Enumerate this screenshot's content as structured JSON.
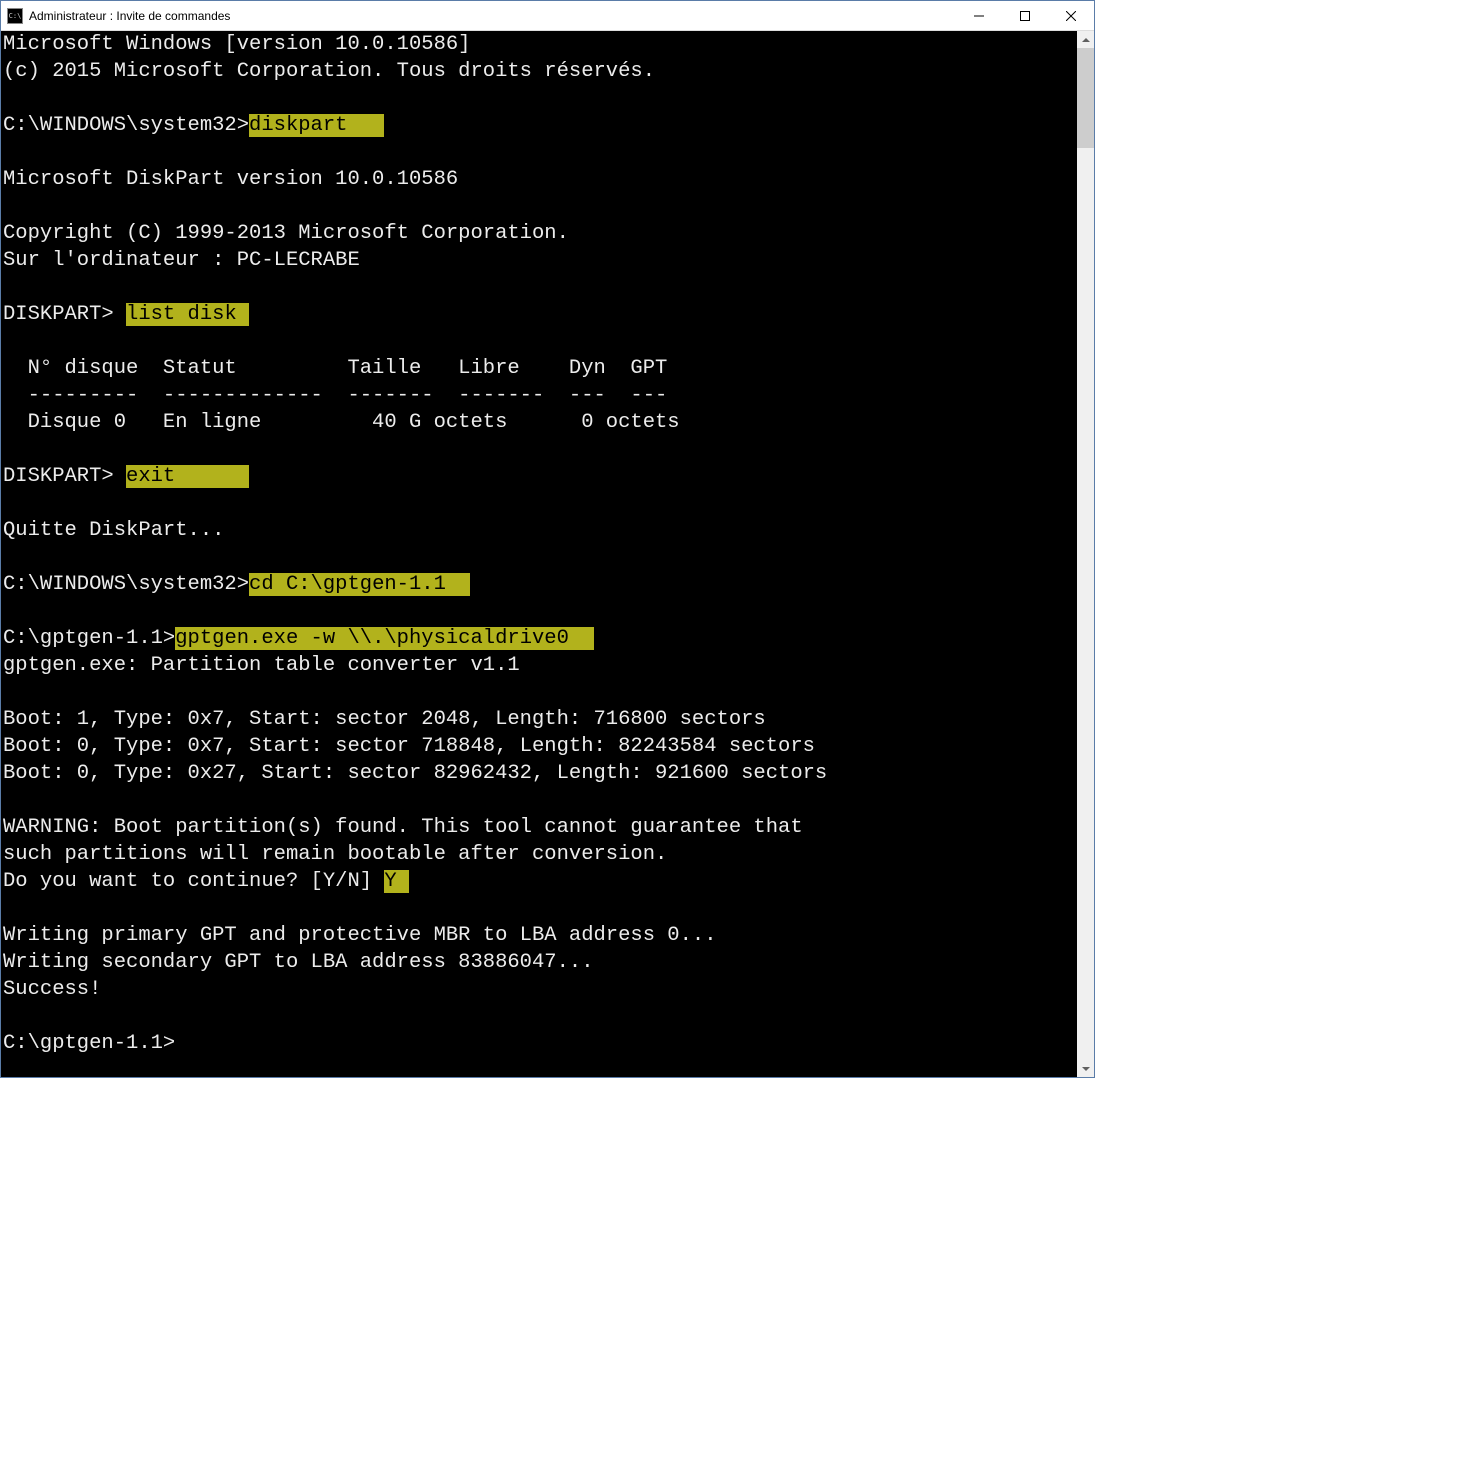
{
  "window": {
    "title": "Administrateur : Invite de commandes",
    "icon_label": "C:\\"
  },
  "terminal": {
    "lines": [
      {
        "segments": [
          {
            "text": "Microsoft Windows [version 10.0.10586]"
          }
        ]
      },
      {
        "segments": [
          {
            "text": "(c) 2015 Microsoft Corporation. Tous droits réservés."
          }
        ]
      },
      {
        "segments": [
          {
            "text": ""
          }
        ]
      },
      {
        "segments": [
          {
            "text": "C:\\WINDOWS\\system32>"
          },
          {
            "text": "diskpart   ",
            "hl": true
          }
        ]
      },
      {
        "segments": [
          {
            "text": ""
          }
        ]
      },
      {
        "segments": [
          {
            "text": "Microsoft DiskPart version 10.0.10586"
          }
        ]
      },
      {
        "segments": [
          {
            "text": ""
          }
        ]
      },
      {
        "segments": [
          {
            "text": "Copyright (C) 1999-2013 Microsoft Corporation."
          }
        ]
      },
      {
        "segments": [
          {
            "text": "Sur l'ordinateur : PC-LECRABE"
          }
        ]
      },
      {
        "segments": [
          {
            "text": ""
          }
        ]
      },
      {
        "segments": [
          {
            "text": "DISKPART> "
          },
          {
            "text": "list disk ",
            "hl": true
          }
        ]
      },
      {
        "segments": [
          {
            "text": ""
          }
        ]
      },
      {
        "segments": [
          {
            "text": "  N° disque  Statut         Taille   Libre    Dyn  GPT"
          }
        ]
      },
      {
        "segments": [
          {
            "text": "  ---------  -------------  -------  -------  ---  ---"
          }
        ]
      },
      {
        "segments": [
          {
            "text": "  Disque 0   En ligne         40 G octets      0 octets"
          }
        ]
      },
      {
        "segments": [
          {
            "text": ""
          }
        ]
      },
      {
        "segments": [
          {
            "text": "DISKPART> "
          },
          {
            "text": "exit      ",
            "hl": true
          }
        ]
      },
      {
        "segments": [
          {
            "text": ""
          }
        ]
      },
      {
        "segments": [
          {
            "text": "Quitte DiskPart..."
          }
        ]
      },
      {
        "segments": [
          {
            "text": ""
          }
        ]
      },
      {
        "segments": [
          {
            "text": "C:\\WINDOWS\\system32>"
          },
          {
            "text": "cd C:\\gptgen-1.1  ",
            "hl": true
          }
        ]
      },
      {
        "segments": [
          {
            "text": ""
          }
        ]
      },
      {
        "segments": [
          {
            "text": "C:\\gptgen-1.1>"
          },
          {
            "text": "gptgen.exe -w \\\\.\\physicaldrive0  ",
            "hl": true
          }
        ]
      },
      {
        "segments": [
          {
            "text": "gptgen.exe: Partition table converter v1.1"
          }
        ]
      },
      {
        "segments": [
          {
            "text": ""
          }
        ]
      },
      {
        "segments": [
          {
            "text": "Boot: 1, Type: 0x7, Start: sector 2048, Length: 716800 sectors"
          }
        ]
      },
      {
        "segments": [
          {
            "text": "Boot: 0, Type: 0x7, Start: sector 718848, Length: 82243584 sectors"
          }
        ]
      },
      {
        "segments": [
          {
            "text": "Boot: 0, Type: 0x27, Start: sector 82962432, Length: 921600 sectors"
          }
        ]
      },
      {
        "segments": [
          {
            "text": ""
          }
        ]
      },
      {
        "segments": [
          {
            "text": "WARNING: Boot partition(s) found. This tool cannot guarantee that"
          }
        ]
      },
      {
        "segments": [
          {
            "text": "such partitions will remain bootable after conversion."
          }
        ]
      },
      {
        "segments": [
          {
            "text": "Do you want to continue? [Y/N] "
          },
          {
            "text": "Y ",
            "hl": true
          }
        ]
      },
      {
        "segments": [
          {
            "text": ""
          }
        ]
      },
      {
        "segments": [
          {
            "text": "Writing primary GPT and protective MBR to LBA address 0..."
          }
        ]
      },
      {
        "segments": [
          {
            "text": "Writing secondary GPT to LBA address 83886047..."
          }
        ]
      },
      {
        "segments": [
          {
            "text": "Success!"
          }
        ]
      },
      {
        "segments": [
          {
            "text": ""
          }
        ]
      },
      {
        "segments": [
          {
            "text": "C:\\gptgen-1.1>"
          }
        ]
      }
    ]
  }
}
